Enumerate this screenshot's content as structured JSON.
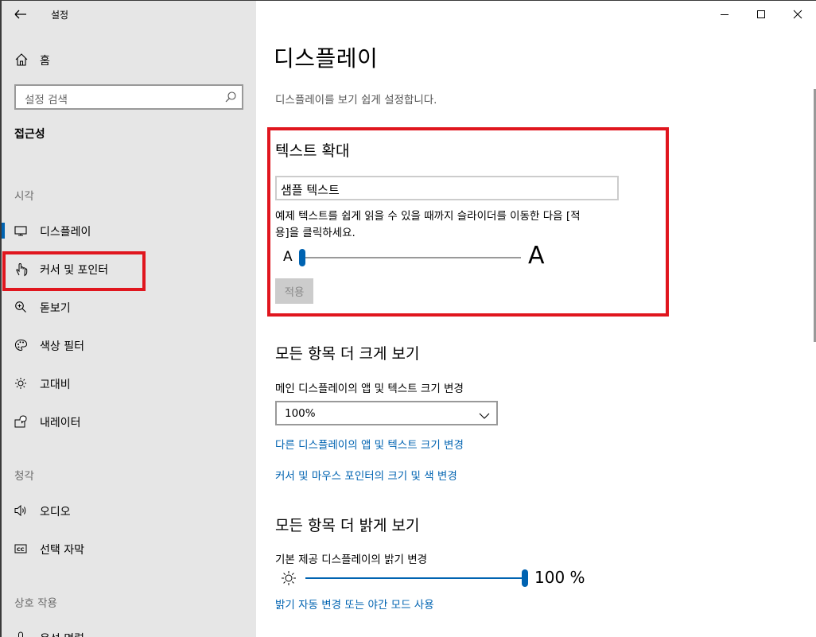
{
  "window": {
    "app_title": "설정",
    "controls": {
      "minimize": "minimize-icon",
      "maximize": "maximize-icon",
      "close": "close-icon"
    }
  },
  "sidebar": {
    "home_label": "홈",
    "search_placeholder": "설정 검색",
    "section_title": "접근성",
    "groups": [
      {
        "label": "시각"
      },
      {
        "label": "청각"
      },
      {
        "label": "상호 작용"
      }
    ],
    "items": [
      {
        "label": "디스플레이",
        "icon": "monitor-icon",
        "active": true
      },
      {
        "label": "커서 및 포인터",
        "icon": "cursor-pointer-icon"
      },
      {
        "label": "돋보기",
        "icon": "magnifier-icon"
      },
      {
        "label": "색상 필터",
        "icon": "palette-icon"
      },
      {
        "label": "고대비",
        "icon": "brightness-icon"
      },
      {
        "label": "내레이터",
        "icon": "narrator-icon"
      },
      {
        "label": "오디오",
        "icon": "speaker-icon"
      },
      {
        "label": "선택 자막",
        "icon": "closed-caption-icon"
      },
      {
        "label": "음성 명령",
        "icon": "microphone-icon"
      }
    ]
  },
  "main": {
    "title": "디스플레이",
    "description": "디스플레이를 보기 쉽게 설정합니다.",
    "text_scale": {
      "heading": "텍스트 확대",
      "sample_text": "샘플 텍스트",
      "help_line1": "예제 텍스트를 쉽게 읽을 수 있을 때까지 슬라이더를 이동한 다음 [적",
      "help_line2": "용]을 클릭하세요.",
      "small_a": "A",
      "big_a": "A",
      "slider_value_fraction": 0,
      "apply_label": "적용"
    },
    "bigger": {
      "heading": "모든 항목 더 크게 보기",
      "scale_label": "메인 디스플레이의 앱 및 텍스트 크기 변경",
      "scale_value": "100%",
      "link_other": "다른 디스플레이의 앱 및 텍스트 크기 변경",
      "link_cursor": "커서 및 마우스 포인터의 크기 및 색 변경"
    },
    "brighter": {
      "heading": "모든 항목 더 밝게 보기",
      "brightness_label": "기본 제공 디스플레이의 밝기 변경",
      "brightness_value": "100 %",
      "brightness_fraction": 1.0,
      "link_night": "밝기 자동 변경 또는 야간 모드 사용"
    }
  },
  "colors": {
    "accent": "#0063b1",
    "highlight_box": "#e0161e",
    "sidebar_bg": "#e6e6e6"
  }
}
